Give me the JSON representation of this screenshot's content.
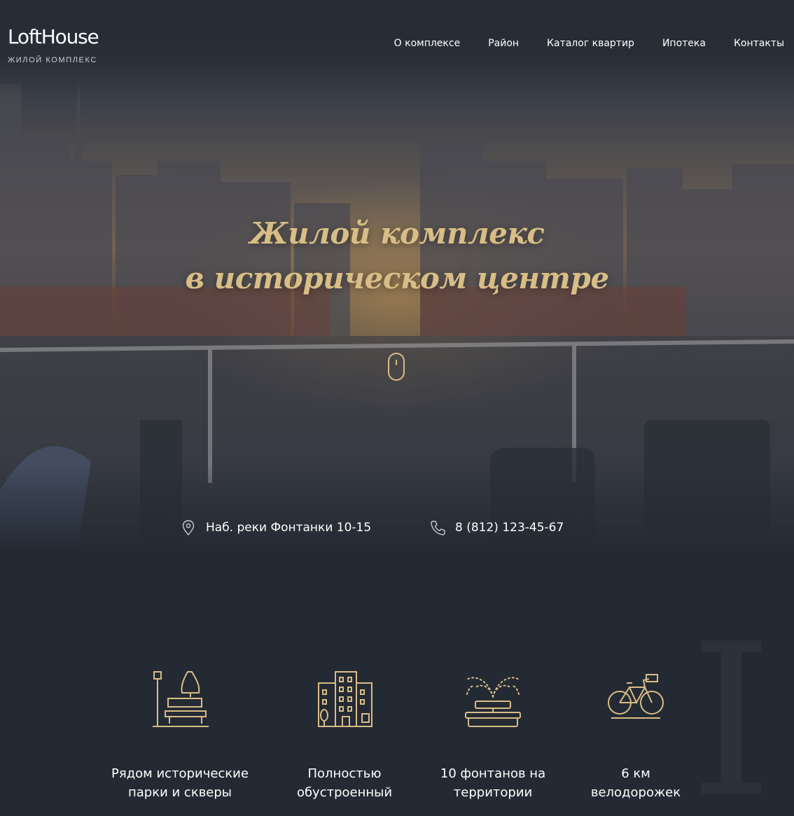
{
  "brand": {
    "name": "LoftHouse",
    "tagline": "ЖИЛОЙ КОМПЛЕКС"
  },
  "nav": {
    "items": [
      {
        "label": "О комплексе"
      },
      {
        "label": "Район"
      },
      {
        "label": "Каталог квартир"
      },
      {
        "label": "Ипотека"
      },
      {
        "label": "Контакты"
      }
    ]
  },
  "hero": {
    "title_line1": "Жилой комплекс",
    "title_line2": "в историческом центре",
    "scroll_icon": "mouse-scroll-icon"
  },
  "contacts": {
    "address": "Наб. реки Фонтанки 10-15",
    "address_icon": "location-pin-icon",
    "phone": "8 (812) 123-45-67",
    "phone_icon": "phone-icon"
  },
  "features": [
    {
      "icon": "park-bench-icon",
      "line1": "Рядом исторические",
      "line2": "парки и скверы"
    },
    {
      "icon": "buildings-icon",
      "line1": "Полностью",
      "line2": "обустроенный"
    },
    {
      "icon": "fountain-icon",
      "line1": "10 фонтанов на",
      "line2": "территории"
    },
    {
      "icon": "bicycle-icon",
      "line1": "6 км",
      "line2": "велодорожек"
    }
  ],
  "colors": {
    "background": "#242a33",
    "accent_gold": "#d8bd86",
    "text": "#ffffff"
  }
}
